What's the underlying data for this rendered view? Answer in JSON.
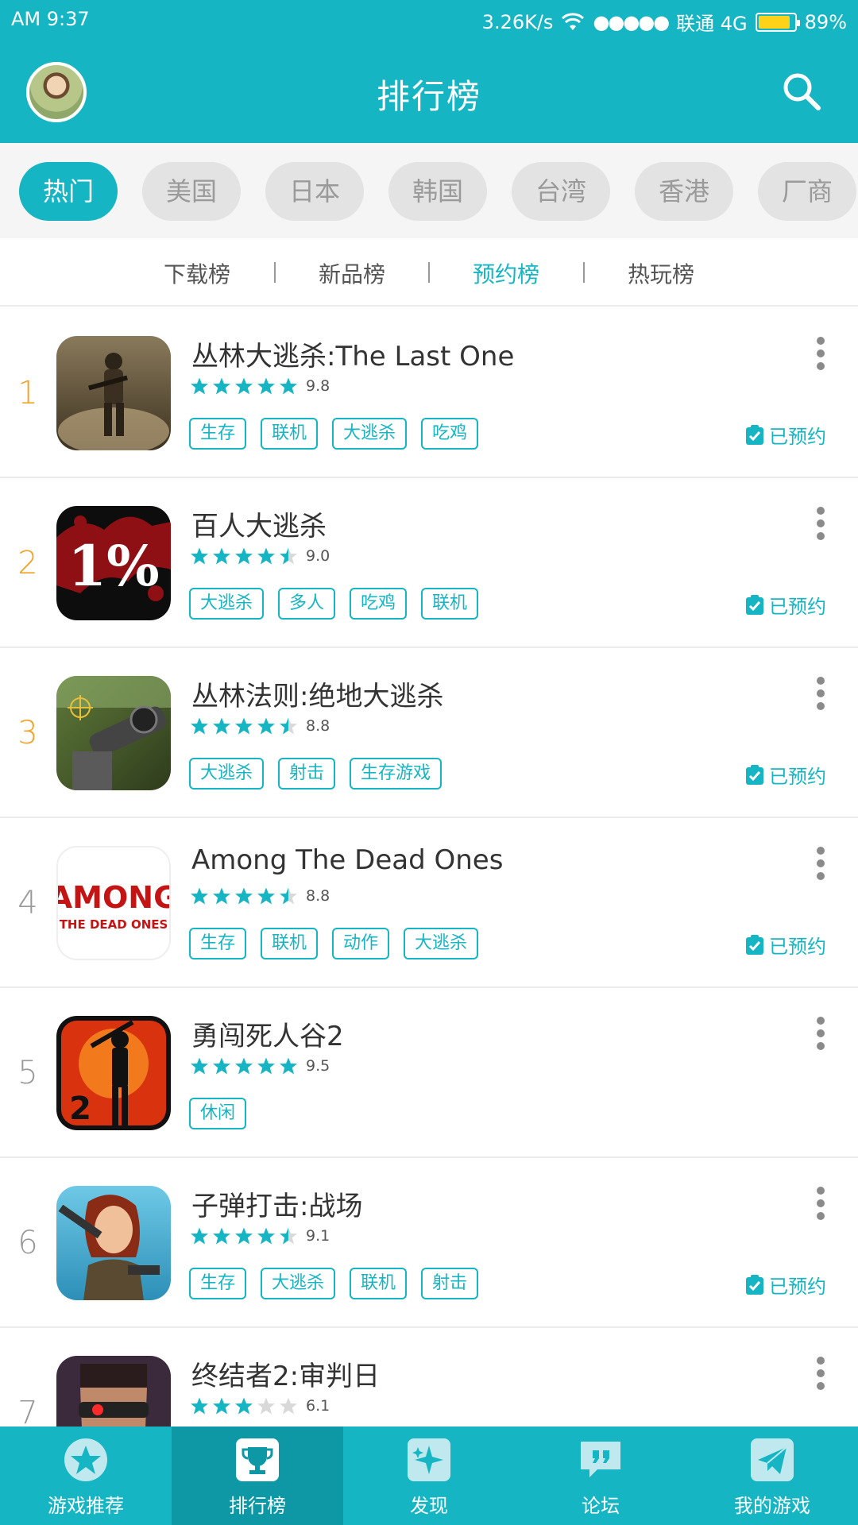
{
  "status_bar": {
    "time": "AM 9:37",
    "speed": "3.26K/s",
    "signal": "●●●●●",
    "carrier": "联通 4G",
    "battery": "89%",
    "battery_level": 0.89
  },
  "header": {
    "title": "排行榜",
    "search_icon": "search-icon",
    "avatar": "user-avatar"
  },
  "regions": [
    "热门",
    "美国",
    "日本",
    "韩国",
    "台湾",
    "香港",
    "厂商"
  ],
  "active_region": "热门",
  "subtabs": [
    "下载榜",
    "新品榜",
    "预约榜",
    "热玩榜"
  ],
  "active_subtab": "预约榜",
  "games": [
    {
      "rank": "1",
      "name": "丛林大逃杀:The Last One",
      "score": "9.8",
      "stars": 5.0,
      "tags": [
        "生存",
        "联机",
        "大逃杀",
        "吃鸡"
      ],
      "status": "已预约"
    },
    {
      "rank": "2",
      "name": "百人大逃杀",
      "score": "9.0",
      "stars": 4.5,
      "tags": [
        "大逃杀",
        "多人",
        "吃鸡",
        "联机"
      ],
      "status": "已预约"
    },
    {
      "rank": "3",
      "name": "丛林法则:绝地大逃杀",
      "score": "8.8",
      "stars": 4.5,
      "tags": [
        "大逃杀",
        "射击",
        "生存游戏"
      ],
      "status": "已预约"
    },
    {
      "rank": "4",
      "name": "Among The Dead Ones",
      "score": "8.8",
      "stars": 4.5,
      "tags": [
        "生存",
        "联机",
        "动作",
        "大逃杀"
      ],
      "status": "已预约"
    },
    {
      "rank": "5",
      "name": "勇闯死人谷2",
      "score": "9.5",
      "stars": 5.0,
      "tags": [
        "休闲"
      ],
      "status": ""
    },
    {
      "rank": "6",
      "name": "子弹打击:战场",
      "score": "9.1",
      "stars": 4.5,
      "tags": [
        "生存",
        "大逃杀",
        "联机",
        "射击"
      ],
      "status": "已预约"
    },
    {
      "rank": "7",
      "name": "终结者2:审判日",
      "score": "6.1",
      "stars": 3.0,
      "tags": [],
      "status": ""
    }
  ],
  "icon_text": {
    "game2": "1%",
    "game4_line1": "AMONG",
    "game4_line2": "THE DEAD ONES",
    "game5": "2"
  },
  "bottom_nav": [
    {
      "label": "游戏推荐",
      "icon": "star-icon"
    },
    {
      "label": "排行榜",
      "icon": "trophy-icon"
    },
    {
      "label": "发现",
      "icon": "sparkle-icon"
    },
    {
      "label": "论坛",
      "icon": "chat-quote-icon"
    },
    {
      "label": "我的游戏",
      "icon": "paper-plane-icon"
    }
  ],
  "active_nav": "排行榜",
  "colors": {
    "accent": "#15b5c3",
    "rank_top": "#f0a326",
    "chip_bg": "#e3e3e3"
  }
}
